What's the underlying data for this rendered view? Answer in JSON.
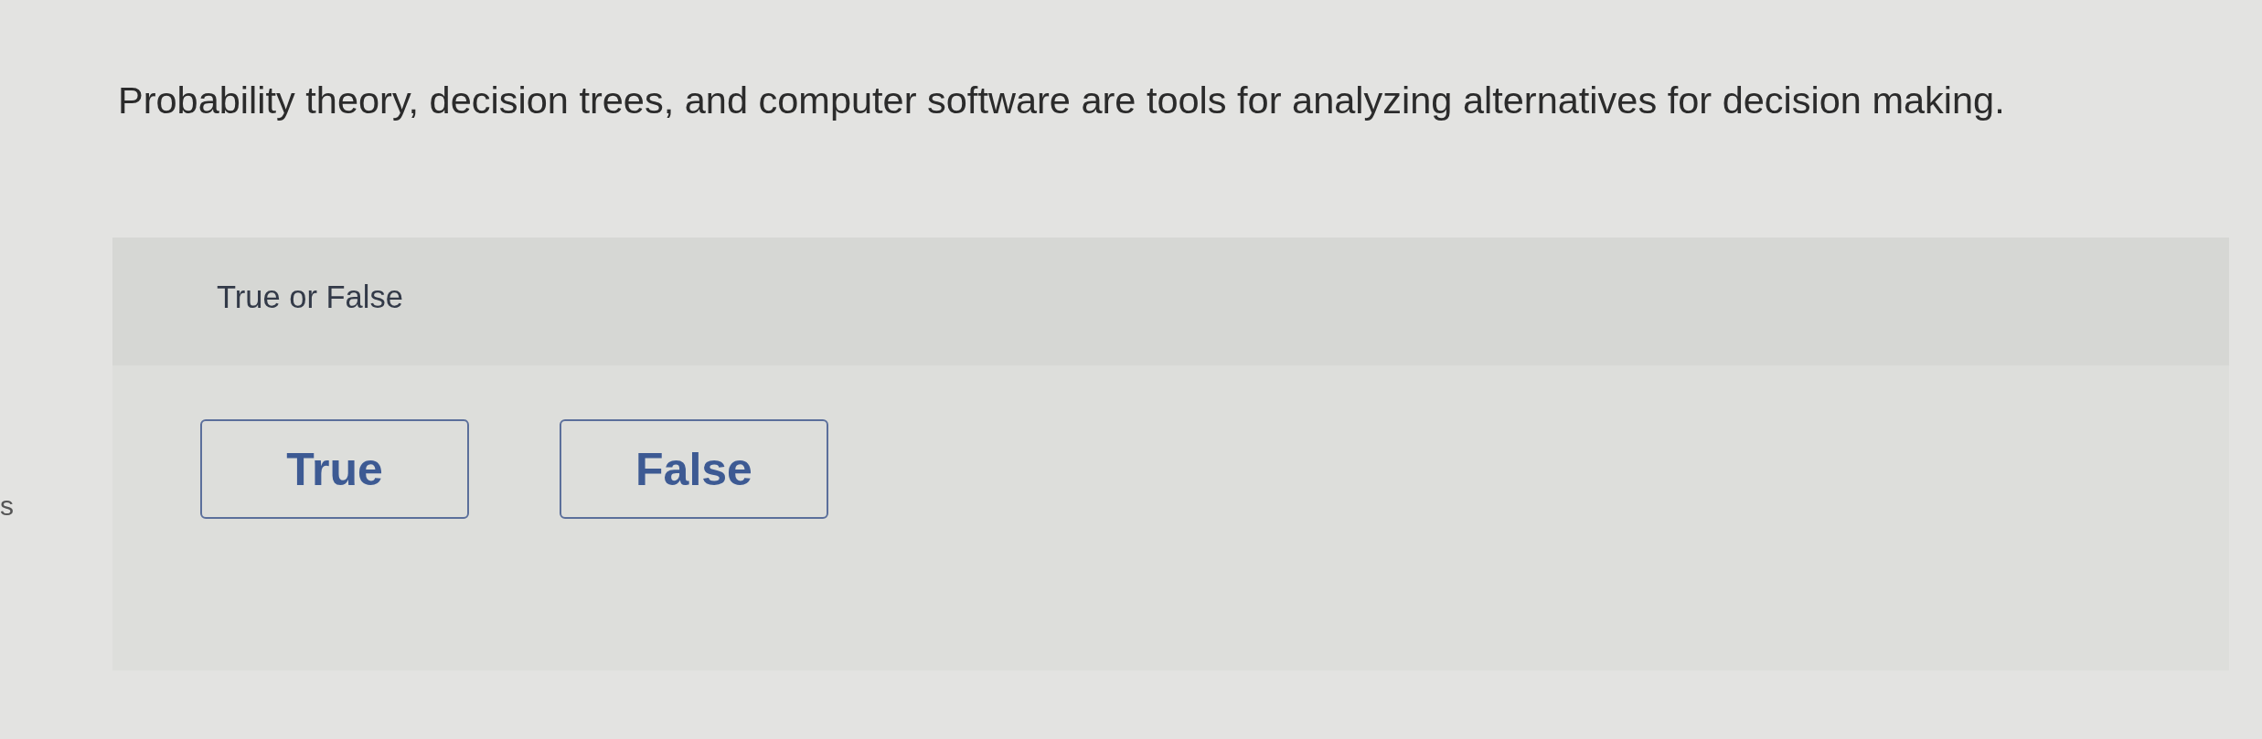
{
  "sidebar": {
    "cut_text": "s"
  },
  "question": {
    "text": "Probability theory, decision trees, and computer software are tools for analyzing alternatives for decision making."
  },
  "answer_panel": {
    "prompt": "True or False",
    "options": [
      {
        "label": "True",
        "selected": false
      },
      {
        "label": "False",
        "selected": false
      }
    ]
  }
}
